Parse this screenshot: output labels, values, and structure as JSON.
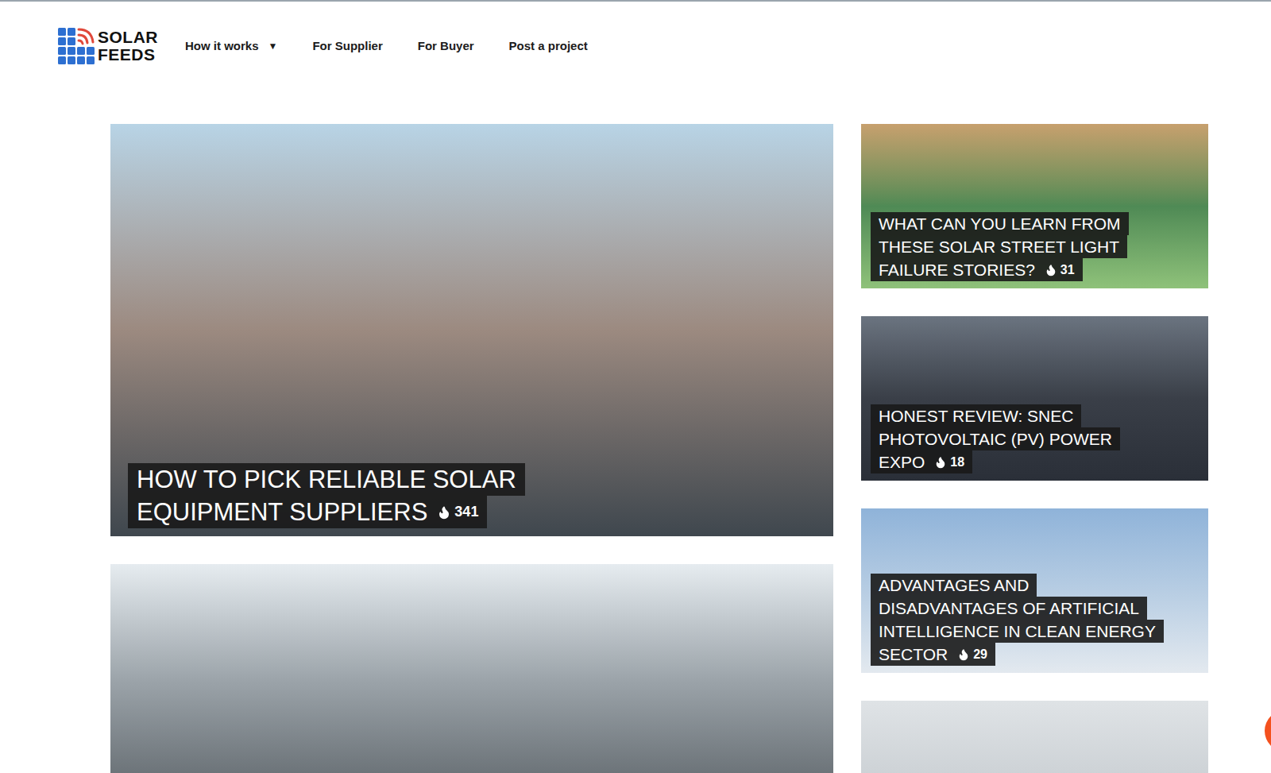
{
  "logo": {
    "line1": "SOLAR",
    "line2": "FEEDS"
  },
  "nav": [
    {
      "label": "How it works",
      "caret": "▼"
    },
    {
      "label": "For Supplier"
    },
    {
      "label": "For Buyer"
    },
    {
      "label": "Post a project"
    }
  ],
  "featured": {
    "lines": [
      "HOW TO PICK RELIABLE SOLAR",
      "EQUIPMENT SUPPLIERS"
    ],
    "count": "341"
  },
  "side_articles": [
    {
      "lines": [
        "WHAT CAN YOU LEARN FROM",
        "THESE SOLAR STREET LIGHT",
        "FAILURE STORIES?"
      ],
      "count": "31"
    },
    {
      "lines": [
        "HONEST REVIEW: SNEC",
        "PHOTOVOLTAIC (PV) POWER",
        "EXPO"
      ],
      "count": "18"
    },
    {
      "lines": [
        "ADVANTAGES AND",
        "DISADVANTAGES OF ARTIFICIAL",
        "INTELLIGENCE IN CLEAN ENERGY",
        "SECTOR"
      ],
      "count": "29"
    }
  ]
}
